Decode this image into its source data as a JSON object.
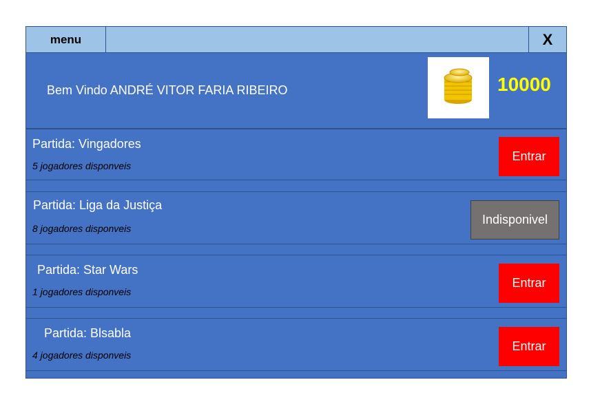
{
  "topbar": {
    "menu_label": "menu",
    "close_label": "X"
  },
  "header": {
    "welcome": "Bem Vindo ANDRÉ VITOR FARIA RIBEIRO",
    "coin_icon": "coin-stack-icon",
    "balance": "10000"
  },
  "matches": [
    {
      "name": "Partida: Vingadores",
      "players": "5 jogadores disponveis",
      "action": "Entrar",
      "status": "available"
    },
    {
      "name": "Partida: Liga da Justiça",
      "players": "8 jogadores disponveis",
      "action": "Indisponivel",
      "status": "unavailable"
    },
    {
      "name": "Partida: Star Wars",
      "players": "1 jogadores disponveis",
      "action": "Entrar",
      "status": "available"
    },
    {
      "name": "Partida: Blsabla",
      "players": "4 jogadores disponveis",
      "action": "Entrar",
      "status": "available"
    }
  ],
  "colors": {
    "panel": "#4472c4",
    "topbar": "#9dc3e6",
    "enter_button": "#ff0000",
    "unavailable_button": "#767171",
    "balance_text": "#ffff00"
  }
}
